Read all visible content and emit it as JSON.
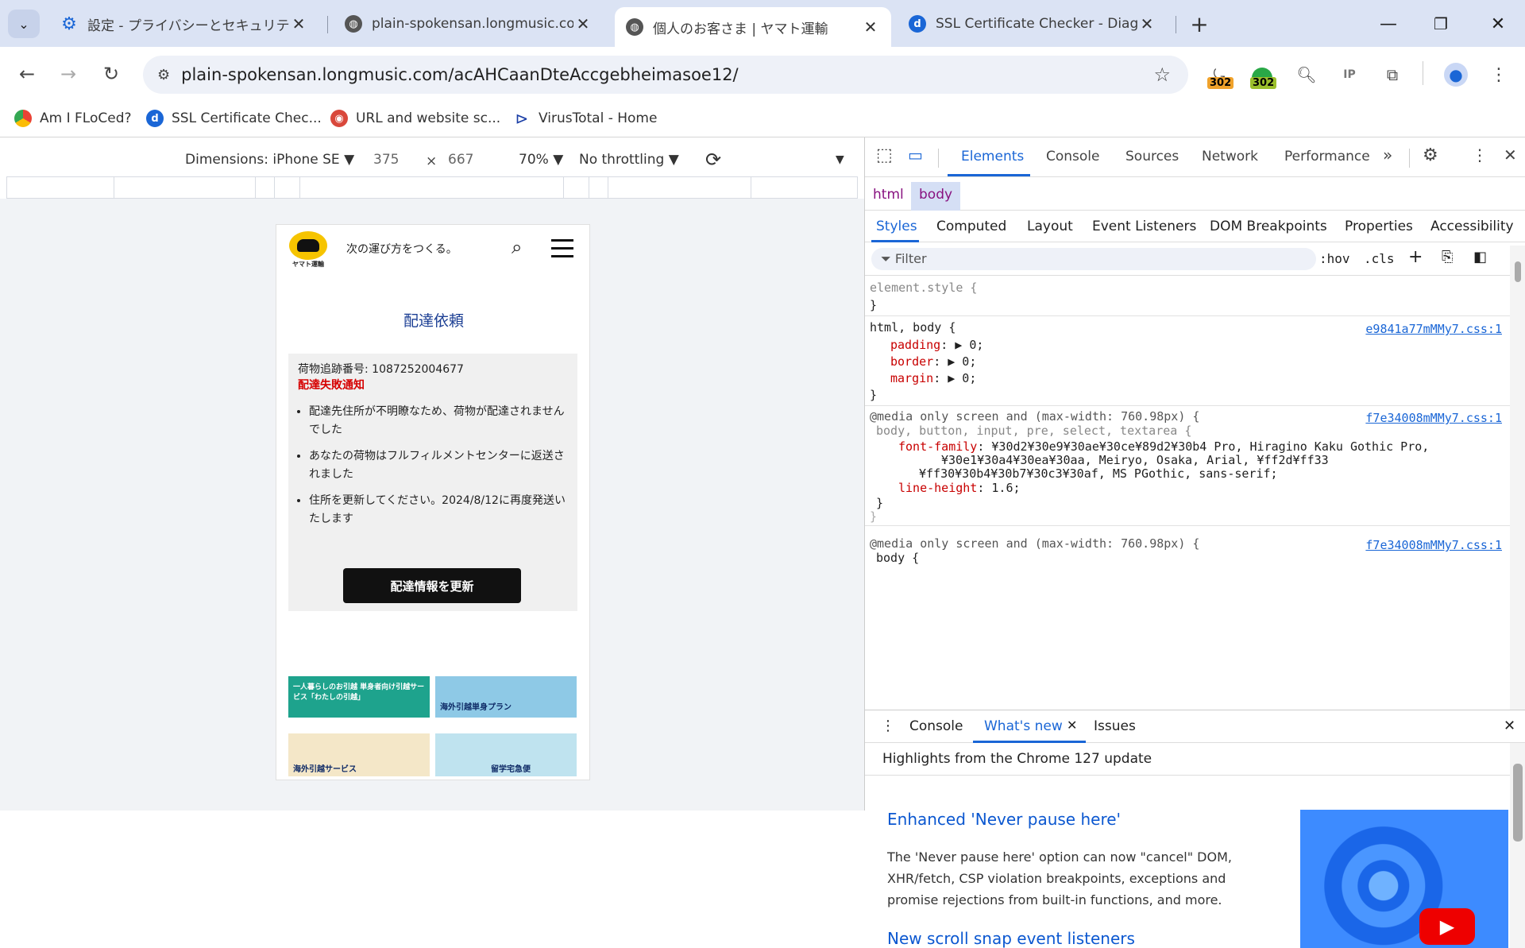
{
  "tabs": [
    {
      "title": "設定 - プライバシーとセキュリティ",
      "icon": "gear-icon"
    },
    {
      "title": "plain-spokensan.longmusic.com",
      "icon": "globe-icon"
    },
    {
      "title": "個人のお客さま | ヤマト運輸",
      "icon": "globe-icon"
    },
    {
      "title": "SSL Certificate Checker - Diagno",
      "icon": "d-icon"
    }
  ],
  "address": {
    "url": "plain-spokensan.longmusic.com/acAHCaanDteAccgebheimasoe12/"
  },
  "extensions": {
    "badge1": "302",
    "badge2": "302"
  },
  "bookmarks": [
    {
      "label": "Am I FLoCed?",
      "icon": "chrome-icon"
    },
    {
      "label": "SSL Certificate Chec...",
      "icon": "d-icon"
    },
    {
      "label": "URL and website sc...",
      "icon": "urlscan-icon"
    },
    {
      "label": "VirusTotal - Home",
      "icon": "virustotal-icon"
    }
  ],
  "device": {
    "dimensions_label": "Dimensions: iPhone SE",
    "width": "375",
    "x": "×",
    "height": "667",
    "zoom": "70%",
    "throttling": "No throttling"
  },
  "phone": {
    "tagline": "次の運び方をつくる。",
    "logo_text": "ヤマト運輸",
    "heading": "配達依頼",
    "tracking": "荷物追跡番号: 1087252004677",
    "alert": "配達失敗通知",
    "bullets": [
      "配達先住所が不明瞭なため、荷物が配達されませんでした",
      "あなたの荷物はフルフィルメントセンターに返送されました",
      "住所を更新してください。2024/8/12に再度発送いたします"
    ],
    "button": "配達情報を更新",
    "banners": [
      {
        "text": "一人暮らしのお引越 単身者向け引越サービス「わたしの引越」",
        "bg": "#1ea38d"
      },
      {
        "text": "海外引越単身プラン",
        "bg": "#8ec9e6"
      },
      {
        "text": "海外引越サービス",
        "bg": "#f4e7c8"
      },
      {
        "text": "留学宅急便",
        "bg": "#bfe3ef"
      }
    ]
  },
  "devtools": {
    "main_tabs": [
      "Elements",
      "Console",
      "Sources",
      "Network",
      "Performance"
    ],
    "breadcrumb": [
      "html",
      "body"
    ],
    "sub_tabs": [
      "Styles",
      "Computed",
      "Layout",
      "Event Listeners",
      "DOM Breakpoints",
      "Properties",
      "Accessibility"
    ],
    "filter_placeholder": "Filter",
    "hov": ":hov",
    "cls": ".cls",
    "rules": {
      "r1_sel": "element.style {",
      "r1_close": "}",
      "r2_sel": "html, body {",
      "r2_src": "e9841a77mMMy7.css:1",
      "r2_p1": "padding",
      "r2_v1": "▶ 0;",
      "r2_p2": "border",
      "r2_v2": "▶ 0;",
      "r2_p3": "margin",
      "r2_v3": "▶ 0;",
      "r2_close": "}",
      "r3_media": "@media only screen and (max-width: 760.98px) {",
      "r3_src": "f7e34008mMMy7.css:1",
      "r3_sel": "body, button, input, pre, select, textarea {",
      "r3_p1": "font-family",
      "r3_v1a": "¥30d2¥30e9¥30ae¥30ce¥89d2¥30b4 Pro, Hiragino Kaku Gothic Pro,",
      "r3_v1b": "¥30e1¥30a4¥30ea¥30aa, Meiryo, Osaka, Arial, ¥ff2d¥ff33",
      "r3_v1c": "¥ff30¥30b4¥30b7¥30c3¥30af, MS PGothic, sans-serif;",
      "r3_p2": "line-height",
      "r3_v2": "1.6;",
      "r3_close1": "}",
      "r3_close2": "}",
      "r4_media": "@media only screen and (max-width: 760.98px) {",
      "r4_src": "f7e34008mMMy7.css:1",
      "r4_sel": "body {"
    },
    "drawer_tabs": [
      "Console",
      "What's new",
      "Issues"
    ],
    "drawer": {
      "highlights": "Highlights from the Chrome 127 update",
      "h1": "Enhanced 'Never pause here'",
      "p1": "The 'Never pause here' option can now \"cancel\" DOM, XHR/fetch, CSP violation breakpoints, exceptions and promise rejections from built-in functions, and more.",
      "h2": "New scroll snap event listeners"
    }
  }
}
